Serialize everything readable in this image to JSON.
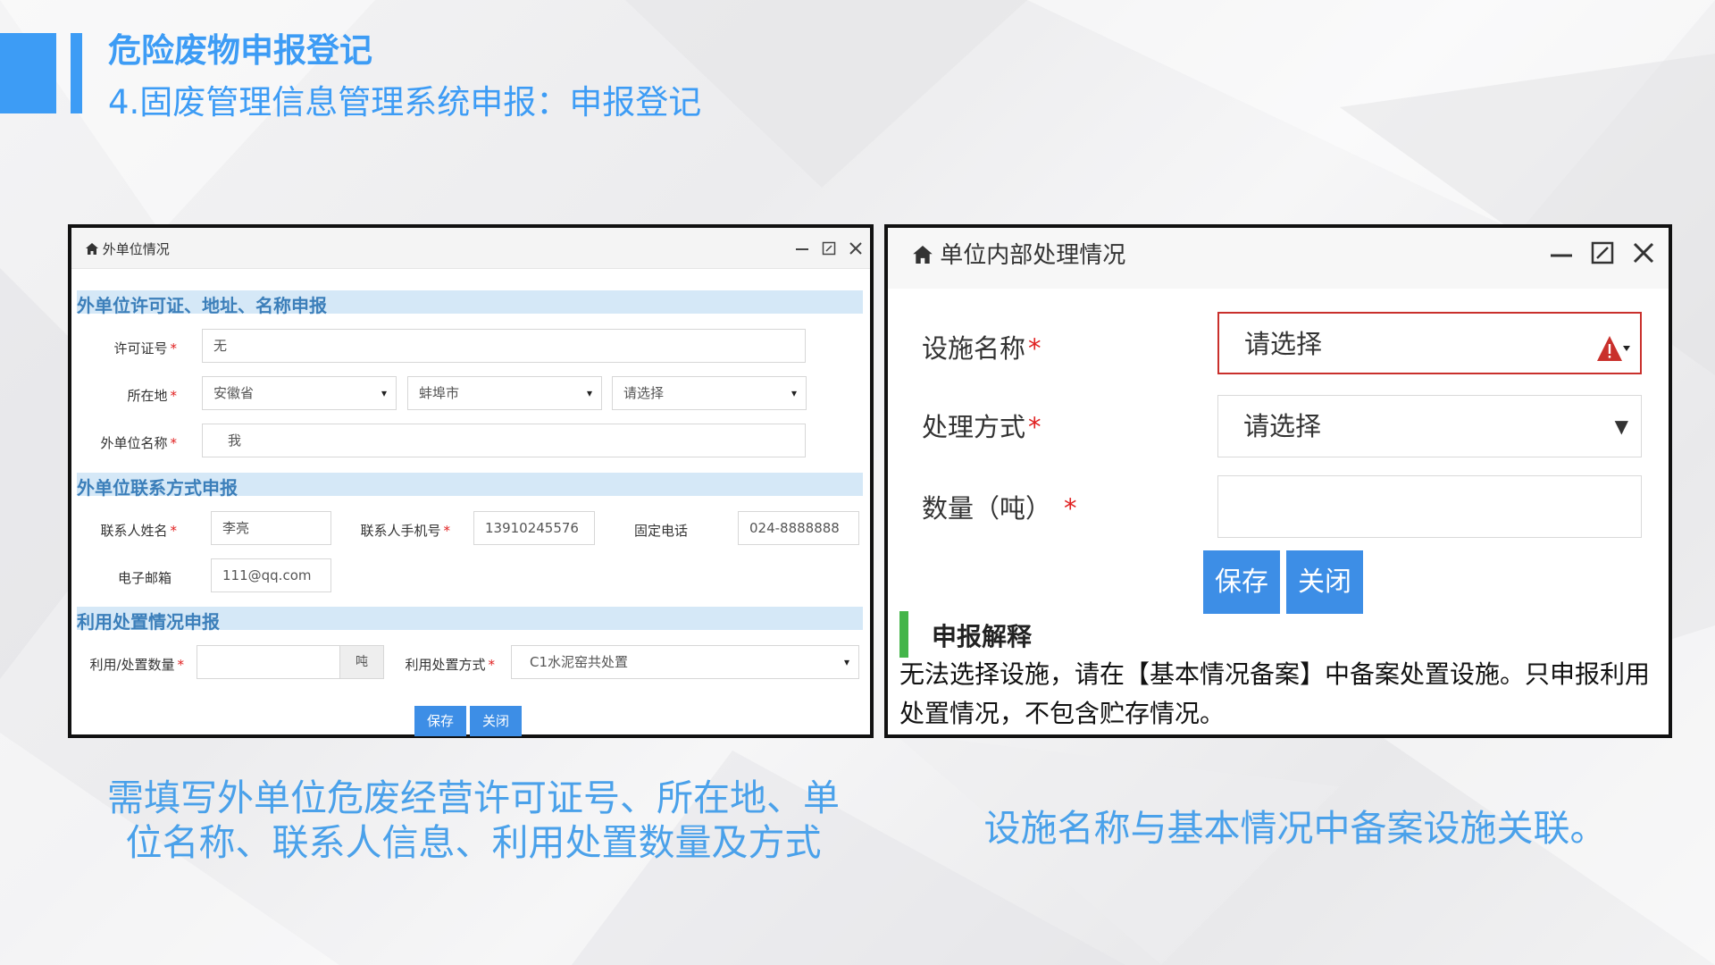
{
  "header": {
    "title": "危险废物申报登记",
    "subtitle": "4.固废管理信息管理系统申报：申报登记"
  },
  "left_window": {
    "title": "外单位情况",
    "section1": "外单位许可证、地址、名称申报",
    "license_label": "许可证号",
    "license_value": "无",
    "location_label": "所在地",
    "province": "安徽省",
    "city": "蚌埠市",
    "district": "请选择",
    "unit_name_label": "外单位名称",
    "unit_name_value": "我",
    "section2": "外单位联系方式申报",
    "contact_name_label": "联系人姓名",
    "contact_name_value": "李亮",
    "contact_phone_label": "联系人手机号",
    "contact_phone_value": "13910245576",
    "landline_label": "固定电话",
    "landline_value": "024-8888888",
    "email_label": "电子邮箱",
    "email_value": "111@qq.com",
    "section3": "利用处置情况申报",
    "qty_label": "利用/处置数量",
    "qty_value": "",
    "qty_unit": "吨",
    "method_label": "利用处置方式",
    "method_value": "C1水泥窑共处置",
    "save": "保存",
    "close": "关闭",
    "required_mark": "*",
    "arrow": "▾"
  },
  "right_window": {
    "title": "单位内部处理情况",
    "facility_label": "设施名称",
    "facility_value": "请选择",
    "method_label": "处理方式",
    "method_value": "请选择",
    "qty_label": "数量（吨）",
    "qty_value": "",
    "save": "保存",
    "close": "关闭",
    "required_mark": "*",
    "explanation_title": "申报解释",
    "explanation_text": "无法选择设施，请在【基本情况备案】中备案处置设施。只申报利用处置情况，不包含贮存情况。"
  },
  "captions": {
    "left": "需填写外单位危废经营许可证号、所在地、单位名称、联系人信息、利用处置数量及方式",
    "right": "设施名称与基本情况中备案设施关联。"
  },
  "colors": {
    "accent": "#3d9cf5",
    "button": "#3d8ee6",
    "section_bg": "#d5e8f7",
    "error": "#c9302c",
    "explanation_bar": "#44b549"
  }
}
